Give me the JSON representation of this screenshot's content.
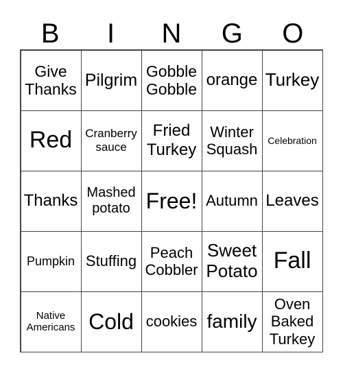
{
  "header": [
    "B",
    "I",
    "N",
    "G",
    "O"
  ],
  "cells": [
    "Give Thanks",
    "Pilgrim",
    "Gobble Gobble",
    "orange",
    "Turkey",
    "Red",
    "Cranberry sauce",
    "Fried Turkey",
    "Winter Squash",
    "Celebration",
    "Thanks",
    "Mashed potato",
    "Free!",
    "Autumn",
    "Leaves",
    "Pumpkin",
    "Stuffing",
    "Peach Cobbler",
    "Sweet Potato",
    "Fall",
    "Native Americans",
    "Cold",
    "cookies",
    "family",
    "Oven Baked Turkey"
  ]
}
